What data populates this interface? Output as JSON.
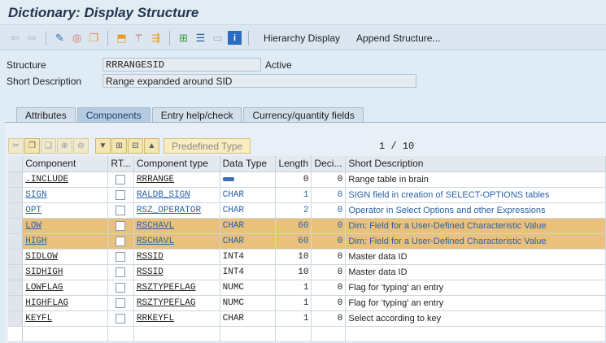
{
  "window": {
    "title": "Dictionary: Display Structure"
  },
  "toolbar": {
    "hierarchy_display": "Hierarchy Display",
    "append_structure": "Append Structure..."
  },
  "header": {
    "structure_label": "Structure",
    "structure_value": "RRRANGESID",
    "status": "Active",
    "short_desc_label": "Short Description",
    "short_desc_value": "Range expanded around SID"
  },
  "tabs": [
    {
      "label": "Attributes"
    },
    {
      "label": "Components"
    },
    {
      "label": "Entry help/check"
    },
    {
      "label": "Currency/quantity fields"
    }
  ],
  "table_toolbar": {
    "predefined_type": "Predefined Type",
    "pager_current": "1",
    "pager_sep": "/",
    "pager_total": "10"
  },
  "columns": [
    "Component",
    "RT...",
    "Component type",
    "Data Type",
    "Length",
    "Deci...",
    "Short Description"
  ],
  "rows": [
    {
      "component": ".INCLUDE",
      "component_type": "RRRANGE",
      "data_type": "",
      "length": "0",
      "decimals": "0",
      "description": "Range table in brain",
      "style": ""
    },
    {
      "component": "SIGN",
      "component_type": "RALDB_SIGN",
      "data_type": "CHAR",
      "length": "1",
      "decimals": "0",
      "description": "SIGN field in creation of SELECT-OPTIONS tables",
      "style": "blue"
    },
    {
      "component": "OPT",
      "component_type": "RSZ_OPERATOR",
      "data_type": "CHAR",
      "length": "2",
      "decimals": "0",
      "description": "Operator in Select Options and other Expressions",
      "style": "blue"
    },
    {
      "component": "LOW",
      "component_type": "RSCHAVL",
      "data_type": "CHAR",
      "length": "60",
      "decimals": "0",
      "description": "Dim: Field for a User-Defined Characteristic Value",
      "style": "hl"
    },
    {
      "component": "HIGH",
      "component_type": "RSCHAVL",
      "data_type": "CHAR",
      "length": "60",
      "decimals": "0",
      "description": "Dim: Field for a User-Defined Characteristic Value",
      "style": "hl"
    },
    {
      "component": "SIDLOW",
      "component_type": "RSSID",
      "data_type": "INT4",
      "length": "10",
      "decimals": "0",
      "description": "Master data ID",
      "style": ""
    },
    {
      "component": "SIDHIGH",
      "component_type": "RSSID",
      "data_type": "INT4",
      "length": "10",
      "decimals": "0",
      "description": "Master data ID",
      "style": ""
    },
    {
      "component": "LOWFLAG",
      "component_type": "RSZTYPEFLAG",
      "data_type": "NUMC",
      "length": "1",
      "decimals": "0",
      "description": "Flag for 'typing' an entry",
      "style": ""
    },
    {
      "component": "HIGHFLAG",
      "component_type": "RSZTYPEFLAG",
      "data_type": "NUMC",
      "length": "1",
      "decimals": "0",
      "description": "Flag for 'typing' an entry",
      "style": ""
    },
    {
      "component": "KEYFL",
      "component_type": "RRKEYFL",
      "data_type": "CHAR",
      "length": "1",
      "decimals": "0",
      "description": "Select according to key",
      "style": ""
    }
  ]
}
